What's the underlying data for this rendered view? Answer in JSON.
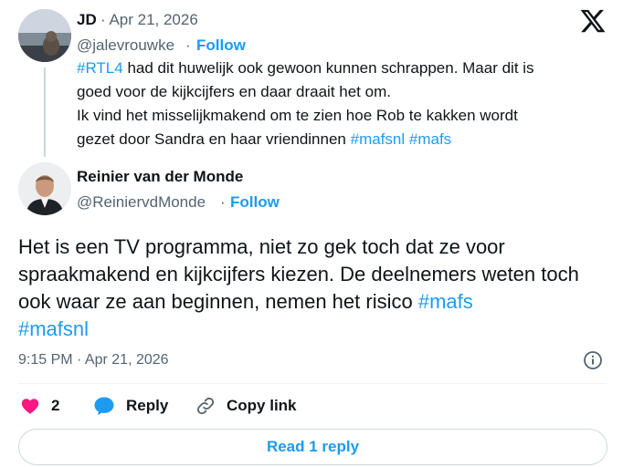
{
  "reply_tweet": {
    "author_name": "JD",
    "date": "· Apr 21, 2026",
    "handle": "@jalevrouwke",
    "dot": "·",
    "follow_label": "Follow",
    "line1_tag": "#RTL4",
    "line1_text": " had dit huwelijk ook gewoon kunnen schrappen. Maar dit is",
    "line2_text": "goed voor de kijkcijfers en daar draait het om.",
    "line3_text": "Ik vind het misselijkmakend om te zien hoe Rob te kakken wordt",
    "line4_text": "gezet door Sandra en haar vriendinnen ",
    "line4_tag1": "#mafsnl",
    "line4_tag2": "#mafs"
  },
  "main_tweet": {
    "author_name": "Reinier van der Monde",
    "handle": "@ReiniervdMonde",
    "dot": "·",
    "follow_label": "Follow",
    "text": "Het is een TV programma, niet zo gek toch dat ze voor spraakmakend en kijkcijfers kiezen. De deelnemers weten toch ook waar ze aan beginnen, nemen het risico ",
    "tag1": "#mafs",
    "tag2": "#mafsnl",
    "timestamp": "9:15 PM · Apr 21, 2026"
  },
  "actions": {
    "like_count": "2",
    "reply_label": "Reply",
    "copy_link_label": "Copy link"
  },
  "read_reply_label": "Read 1 reply",
  "icons": [
    "x-logo-icon",
    "info-icon",
    "heart-icon",
    "reply-bubble-icon",
    "link-icon"
  ],
  "colors": {
    "accent": "#1d9bf0",
    "like": "#f91880",
    "text": "#0f1419",
    "muted": "#536471"
  }
}
